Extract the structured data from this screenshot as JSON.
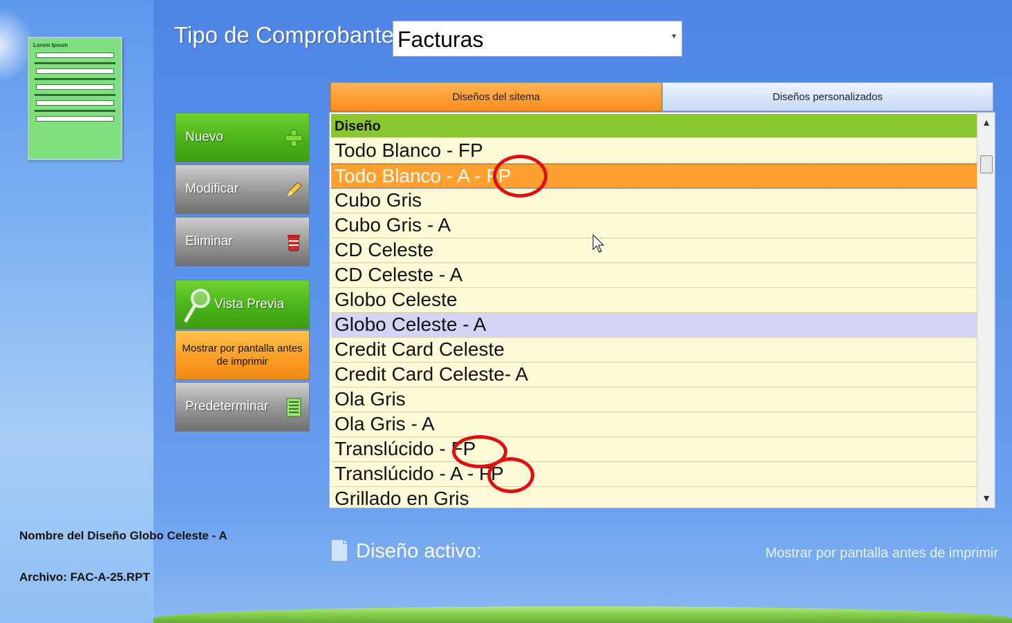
{
  "header": {
    "tipo_label": "Tipo de Comprobante:",
    "tipo_value": "Facturas"
  },
  "buttons": {
    "nuevo": "Nuevo",
    "modificar": "Modificar",
    "eliminar": "Eliminar",
    "vista_previa": "Vista Previa",
    "mostrar": "Mostrar por pantalla antes de imprimir",
    "predeterminar": "Predeterminar"
  },
  "tabs": {
    "sistema": "Diseños del sitema",
    "personalizados": "Diseños personalizados"
  },
  "grid": {
    "header": "Diseño",
    "rows": [
      "Todo Blanco - FP",
      "Todo Blanco - A - FP",
      "Cubo Gris",
      "Cubo Gris - A",
      "CD Celeste",
      "CD Celeste - A",
      "Globo Celeste",
      "Globo Celeste - A",
      "Credit Card Celeste",
      "Credit Card Celeste- A",
      "Ola Gris",
      "Ola Gris - A",
      "Translúcido - FP",
      "Translúcido - A - FP",
      "Grillado en Gris"
    ]
  },
  "footer": {
    "nombre": "Nombre del Diseño Globo Celeste - A",
    "archivo": "Archivo: FAC-A-25.RPT",
    "diseno_activo": "Diseño activo:",
    "mostrar_status": "Mostrar por pantalla antes de imprimir"
  },
  "thumbnail": {
    "title": "Lorem Ipsum"
  },
  "colors": {
    "accent_green": "#49b31a",
    "selection_orange": "#ffa030",
    "grid_background": "#fffbd9",
    "highlight_circle": "#e01010"
  }
}
